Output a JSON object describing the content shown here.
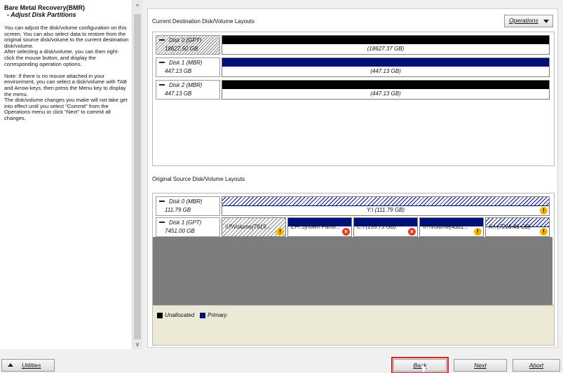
{
  "sidebar": {
    "title": "Bare Metal Recovery(BMR)",
    "subtitle": "- Adjust Disk Partitions",
    "body": "You can adjust the disk/volume configuration on this screen. You can also select data to restore from the original source disk/volume to the current destination disk/volume.\nAfter selecting a disk/volume, you can then right-click the mouse button, and display the corresponding operation options.\n\nNote: If there is no mouse attached in your environment, you can select a disk/volume with TAB and Arrow keys, then press the Menu key to display the menu.\nThe disk/volume changes you make will not take get into effect until you select \"Commit\" from the Operations menu or click \"Next\" to commit all changes."
  },
  "scrollbar": {
    "up": "^",
    "down": "v"
  },
  "destination": {
    "label": "Current Destination Disk/Volume Layouts",
    "operations_label": "Operations",
    "disks": [
      {
        "name": "Disk 0 (GPT)",
        "size": "18627.50 GB",
        "volume": "(18627.37 GB)"
      },
      {
        "name": "Disk 1 (MBR)",
        "size": "447.13 GB",
        "volume": "(447.13 GB)"
      },
      {
        "name": "Disk 2 (MBR)",
        "size": "447.13 GB",
        "volume": "(447.13 GB)"
      }
    ]
  },
  "source": {
    "label": "Original Source Disk/Volume Layouts",
    "disk0": {
      "name": "Disk 0 (MBR)",
      "size": "111.79 GB",
      "volume": "Y:\\ (111.79 GB)"
    },
    "disk1": {
      "name": "Disk 1 (GPT)",
      "size": "7451.00 GB",
      "volumes": [
        {
          "text": "\\\\?\\Volume{7919..."
        },
        {
          "text": "EFI System Partiti..."
        },
        {
          "text": "C:\\ (155.73 GB)"
        },
        {
          "text": "\\\\?\\Volume{4dd1..."
        },
        {
          "text": "X:\\ (7218.46 GB)"
        }
      ]
    }
  },
  "legend": {
    "unallocated": "Unallocated",
    "primary": "Primary"
  },
  "colors": {
    "unallocated": "#000000",
    "primary": "#00107a",
    "highlight": "#d81f1f"
  },
  "buttons": {
    "utilities": "Utilities",
    "back": "Back",
    "next": "Next",
    "abort": "Abort"
  }
}
